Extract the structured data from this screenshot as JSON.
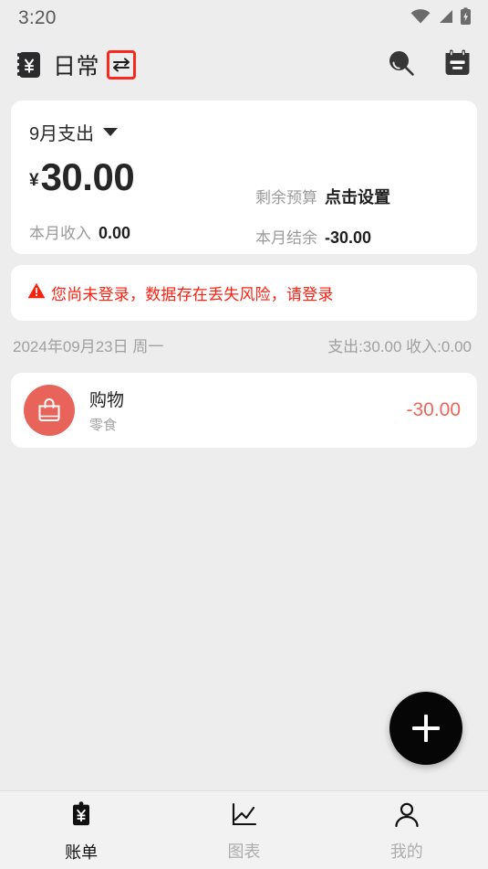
{
  "statusbar": {
    "time": "3:20",
    "icons": [
      "wifi-icon",
      "cellular-signal-icon",
      "battery-charging-icon"
    ]
  },
  "appbar": {
    "ledger_icon": "ledger-yen-icon",
    "title": "日常",
    "swap_icon": "swap-horizontal-icon",
    "swap_highlight_color": "#f8281e",
    "search_icon": "search-icon",
    "calendar_icon": "calendar-icon"
  },
  "summary": {
    "month_selector_label": "9月支出",
    "dropdown_icon": "caret-down-icon",
    "currency_symbol": "¥",
    "amount": "30.00",
    "income_label": "本月收入",
    "income_value": "0.00",
    "budget_label": "剩余预算",
    "budget_value": "点击设置",
    "balance_label": "本月结余",
    "balance_value": "-30.00"
  },
  "warning": {
    "icon": "warning-triangle-icon",
    "text": "您尚未登录，数据存在丢失风险，请登录",
    "color": "#ff1f0f"
  },
  "day_group": {
    "date": "2024年09月23日 周一",
    "totals": "支出:30.00  收入:0.00",
    "transactions": [
      {
        "icon": "shopping-bag-icon",
        "icon_color": "#e8645a",
        "title": "购物",
        "subtitle": "零食",
        "amount": "-30.00",
        "amount_color": "#ee6559"
      }
    ]
  },
  "fab": {
    "icon": "plus-icon",
    "color": "#060606"
  },
  "bottomnav": {
    "items": [
      {
        "icon": "bill-clipboard-yen-icon",
        "label": "账单",
        "active": true
      },
      {
        "icon": "chart-line-icon",
        "label": "图表",
        "active": false
      },
      {
        "icon": "person-icon",
        "label": "我的",
        "active": false
      }
    ]
  }
}
